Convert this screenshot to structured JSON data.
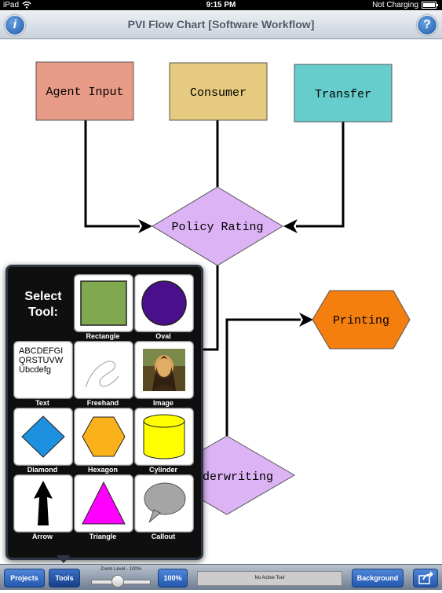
{
  "status_bar": {
    "device": "iPad",
    "time": "9:15 PM",
    "battery": "Not Charging"
  },
  "nav": {
    "title": "PVI Flow Chart [Software Workflow]",
    "info_glyph": "i",
    "help_glyph": "?"
  },
  "flowchart": {
    "nodes": {
      "agent_input": {
        "label": "Agent Input",
        "color": "#e89b86"
      },
      "consumer": {
        "label": "Consumer",
        "color": "#e6ca7f"
      },
      "transfer": {
        "label": "Transfer",
        "color": "#66cccc"
      },
      "policy_rating": {
        "label": "Policy Rating",
        "color": "#dcb3f5"
      },
      "printing": {
        "label": "Printing",
        "color": "#f57f0e"
      },
      "underwriting": {
        "label": "derwriting",
        "color": "#dcb3f5"
      }
    }
  },
  "tool_picker": {
    "title_line1": "Select",
    "title_line2": "Tool:",
    "tools": [
      {
        "label": "Rectangle",
        "icon": "rectangle-icon"
      },
      {
        "label": "Oval",
        "icon": "oval-icon"
      },
      {
        "label": "Text",
        "icon": "text-icon",
        "sample_lines": [
          "ABCDEFGI",
          "QRSTUVW",
          "Übcdefg"
        ]
      },
      {
        "label": "Freehand",
        "icon": "freehand-icon"
      },
      {
        "label": "Image",
        "icon": "image-icon"
      },
      {
        "label": "Diamond",
        "icon": "diamond-icon"
      },
      {
        "label": "Hexagon",
        "icon": "hexagon-icon"
      },
      {
        "label": "Cylinder",
        "icon": "cylinder-icon"
      },
      {
        "label": "Arrow",
        "icon": "arrow-icon"
      },
      {
        "label": "Triangle",
        "icon": "triangle-icon"
      },
      {
        "label": "Callout",
        "icon": "callout-icon"
      }
    ]
  },
  "toolbar": {
    "projects_label": "Projects",
    "tools_label": "Tools",
    "zoom_label": "Zoom Level - 100%",
    "zoom_fraction": 0.45,
    "zoom_button_label": "100%",
    "status_text": "No Active Tool",
    "background_label": "Background",
    "share_icon": "share-icon"
  }
}
